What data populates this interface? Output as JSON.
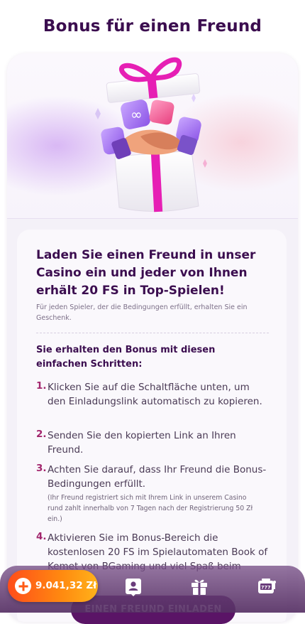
{
  "page": {
    "title": "Bonus für einen Freund"
  },
  "info": {
    "headline": "Laden Sie einen Freund in unser Casino ein und jeder von Ihnen erhält 20 FS in Top-Spielen!",
    "subtext": "Für jeden Spieler, der die Bedingungen erfüllt, erhalten Sie ein Geschenk.",
    "steps_heading": "Sie erhalten den Bonus mit diesen einfachen Schritten:",
    "steps": [
      {
        "num": "1.",
        "text": "Klicken Sie auf die Schaltfläche unten, um den Einladungslink automatisch zu kopieren.",
        "note": ""
      },
      {
        "num": "2.",
        "text": "Senden Sie den kopierten Link an Ihren Freund.",
        "note": ""
      },
      {
        "num": "3.",
        "text": "Achten Sie darauf, dass Ihr Freund die Bonus-Bedingungen erfüllt.",
        "note": "(Ihr Freund registriert sich mit Ihrem Link in unserem Casino rund zahlt innerhalb von 7 Tagen nach der Registrierung 50 Zł ein.)"
      },
      {
        "num": "4.",
        "text": "Aktivieren Sie im Bonus-Bereich die kostenlosen 20 FS im Spielautomaten Book of Kemet von BGaming und viel Spaß beim",
        "note": ""
      }
    ]
  },
  "cta": {
    "label": "EINEN FREUND EINLADEN"
  },
  "bottom_nav": {
    "balance": "9.041,32 Zł",
    "icons": [
      "add-funds-icon",
      "profile-card-icon",
      "gift-icon",
      "slot-machine-icon"
    ]
  },
  "colors": {
    "title": "#3b0d4f",
    "step_number": "#a2266d",
    "balance_gradient_start": "#ff4d1a",
    "balance_gradient_end": "#ffb21a",
    "nav_background": "#563064",
    "ribbon": "#e61fb4"
  }
}
